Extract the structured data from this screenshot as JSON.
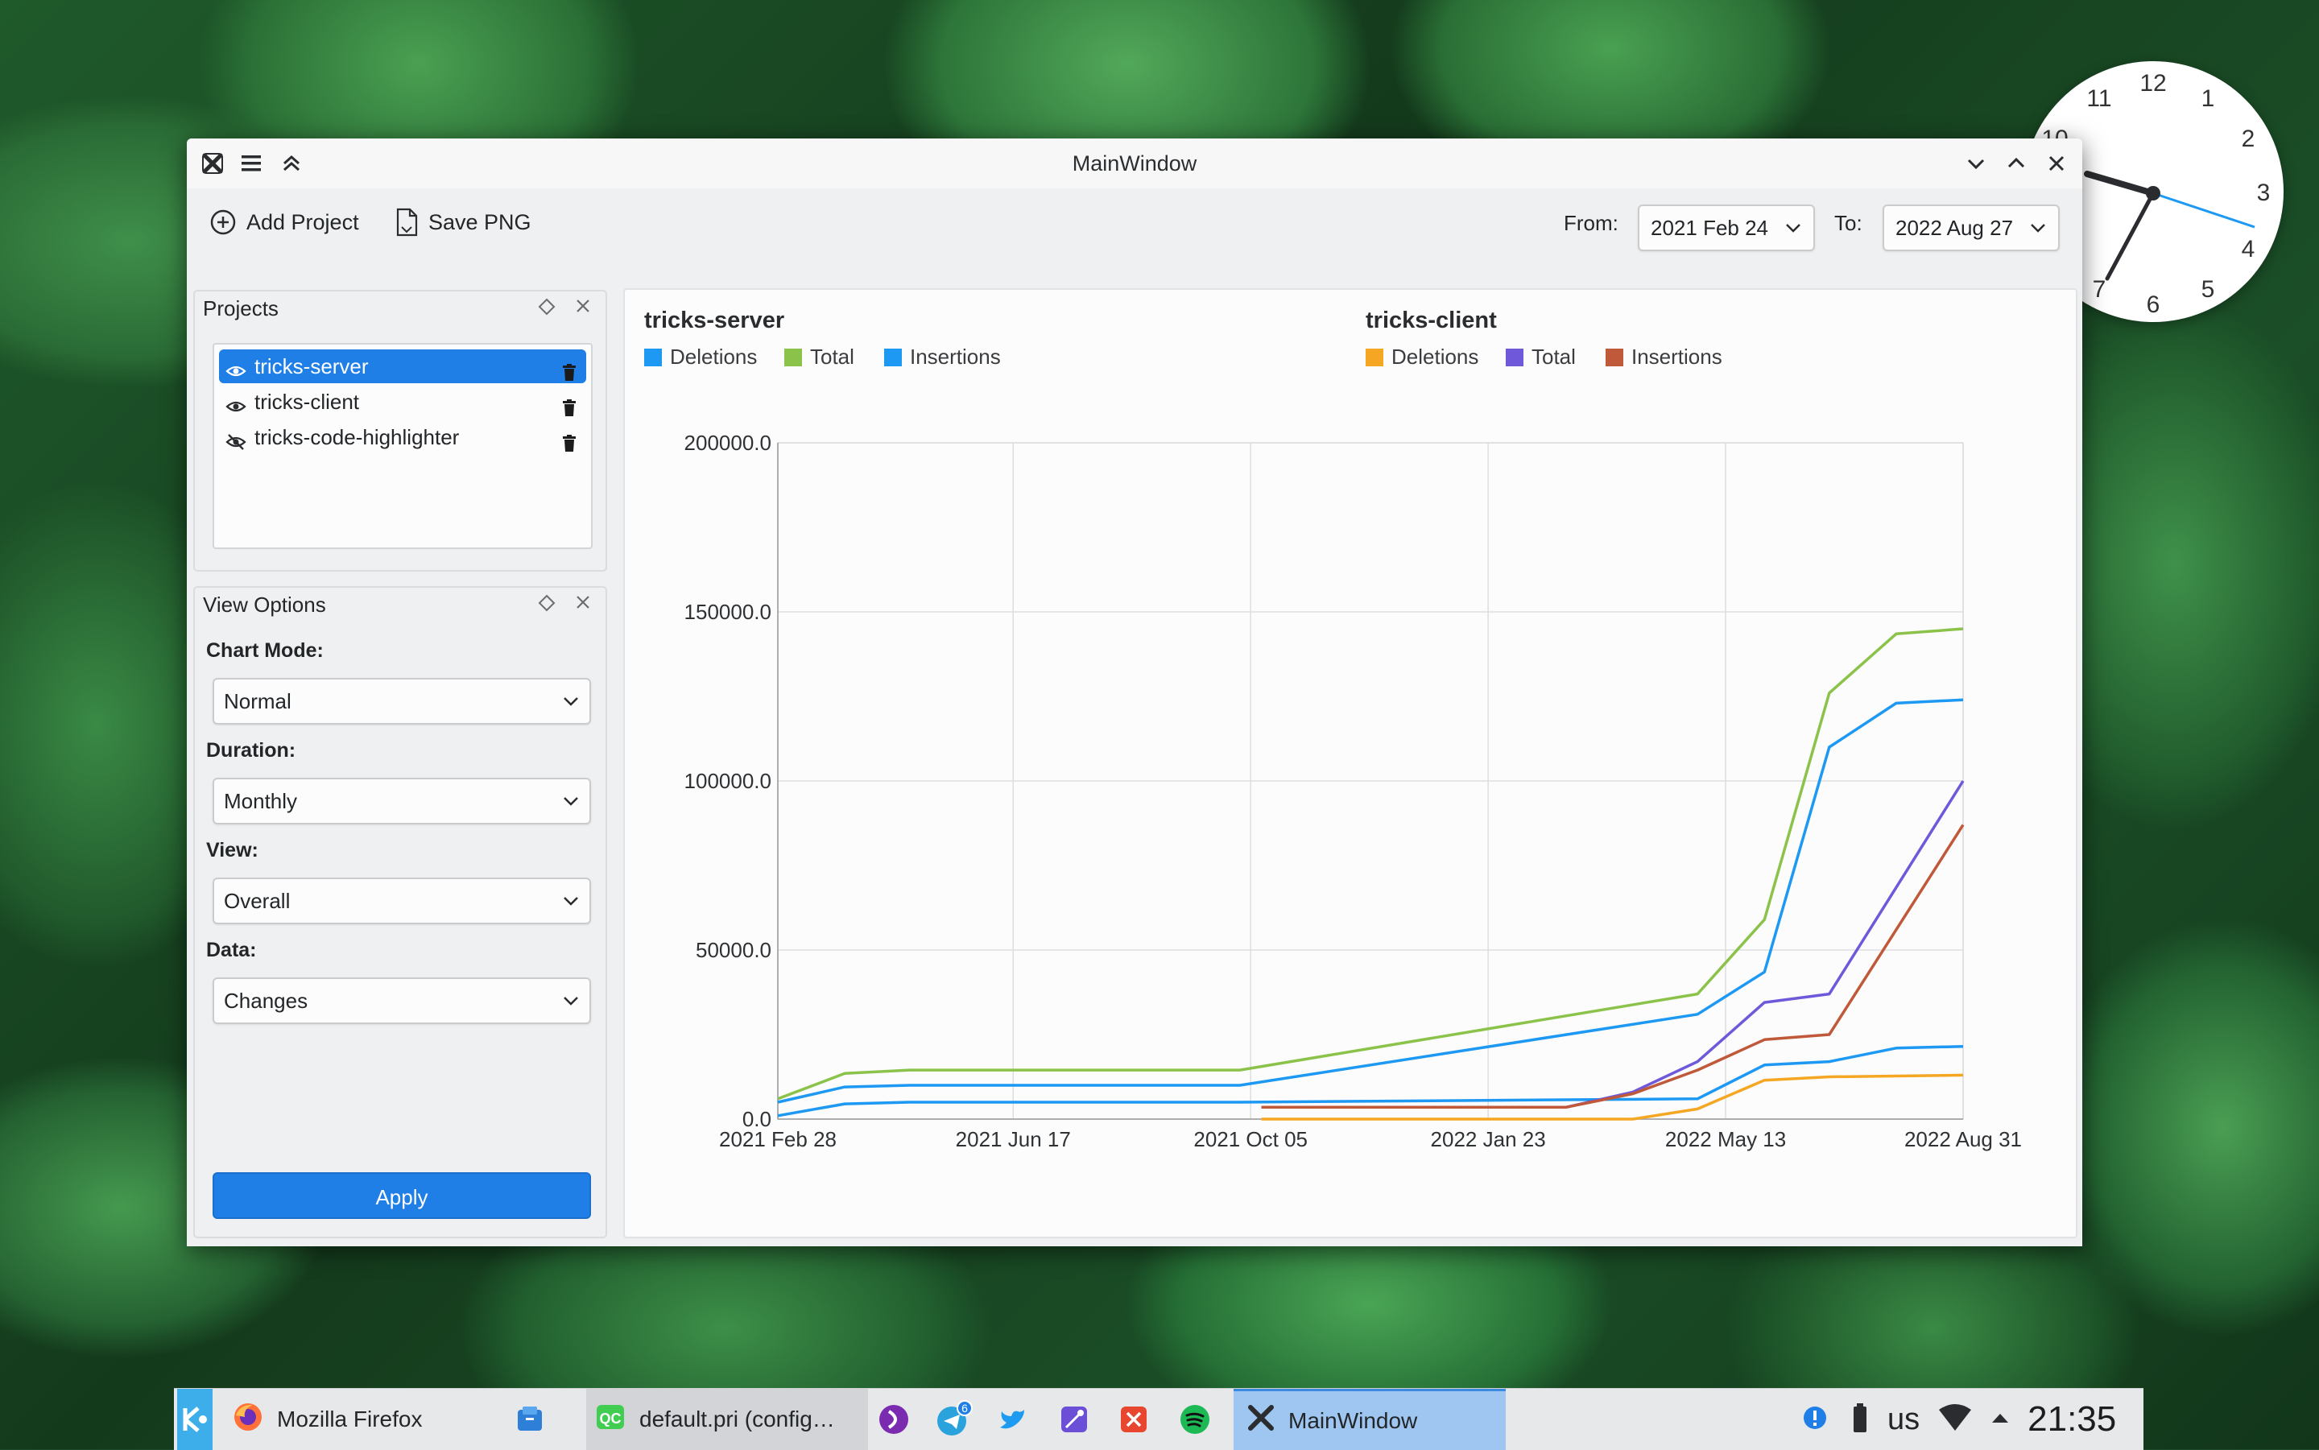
{
  "window": {
    "title": "MainWindow"
  },
  "toolbar": {
    "add_project": "Add Project",
    "save_png": "Save PNG",
    "from_label": "From:",
    "from_value": "2021 Feb 24",
    "to_label": "To:",
    "to_value": "2022 Aug 27"
  },
  "projects_dock": {
    "title": "Projects",
    "items": [
      {
        "label": "tricks-server",
        "visible": true,
        "selected": true
      },
      {
        "label": "tricks-client",
        "visible": true,
        "selected": false
      },
      {
        "label": "tricks-code-highlighter",
        "visible": false,
        "selected": false
      }
    ]
  },
  "view_options": {
    "title": "View Options",
    "chart_mode_label": "Chart Mode:",
    "chart_mode_value": "Normal",
    "duration_label": "Duration:",
    "duration_value": "Monthly",
    "view_label": "View:",
    "view_value": "Overall",
    "data_label": "Data:",
    "data_value": "Changes",
    "apply_label": "Apply"
  },
  "chart_data": {
    "type": "line",
    "projects": [
      {
        "name": "tricks-server",
        "legend": [
          "Deletions",
          "Total",
          "Insertions"
        ]
      },
      {
        "name": "tricks-client",
        "legend": [
          "Deletions",
          "Total",
          "Insertions"
        ]
      }
    ],
    "x_dates": [
      "2021-02-28",
      "2021-06-17",
      "2021-10-05",
      "2022-01-23",
      "2022-05-13",
      "2022-08-31"
    ],
    "x_tick_labels": [
      "2021 Feb 28",
      "2021 Jun 17",
      "2021 Oct 05",
      "2022 Jan 23",
      "2022 May 13",
      "2022 Aug 31"
    ],
    "y_tick_labels": [
      "0.0",
      "50000.0",
      "100000.0",
      "150000.0",
      "200000.0"
    ],
    "ylim": [
      0,
      200000
    ],
    "grid": true,
    "series": [
      {
        "project": "tricks-server",
        "name": "Deletions",
        "color": "#1d99f3",
        "points": [
          [
            "2021-02-28",
            1000
          ],
          [
            "2021-03-31",
            4500
          ],
          [
            "2021-04-30",
            5000
          ],
          [
            "2021-07-31",
            5000
          ],
          [
            "2021-09-30",
            5000
          ],
          [
            "2022-04-30",
            6000
          ],
          [
            "2022-05-31",
            16000
          ],
          [
            "2022-06-30",
            17000
          ],
          [
            "2022-07-31",
            21000
          ],
          [
            "2022-08-31",
            21500
          ]
        ]
      },
      {
        "project": "tricks-server",
        "name": "Total",
        "color": "#8bc34a",
        "points": [
          [
            "2021-02-28",
            6000
          ],
          [
            "2021-03-31",
            13500
          ],
          [
            "2021-04-30",
            14500
          ],
          [
            "2021-09-30",
            14500
          ],
          [
            "2022-04-30",
            37000
          ],
          [
            "2022-05-31",
            59000
          ],
          [
            "2022-06-30",
            126000
          ],
          [
            "2022-07-31",
            143500
          ],
          [
            "2022-08-31",
            145000
          ]
        ]
      },
      {
        "project": "tricks-server",
        "name": "Insertions",
        "color": "#1d99f3",
        "points": [
          [
            "2021-02-28",
            5000
          ],
          [
            "2021-03-31",
            9500
          ],
          [
            "2021-04-30",
            10000
          ],
          [
            "2021-09-30",
            10000
          ],
          [
            "2022-04-30",
            31000
          ],
          [
            "2022-05-31",
            43500
          ],
          [
            "2022-06-30",
            110000
          ],
          [
            "2022-07-31",
            123000
          ],
          [
            "2022-08-31",
            124000
          ]
        ]
      },
      {
        "project": "tricks-client",
        "name": "Deletions",
        "color": "#f5a623",
        "points": [
          [
            "2021-10-10",
            0
          ],
          [
            "2022-03-31",
            0
          ],
          [
            "2022-04-30",
            3000
          ],
          [
            "2022-05-31",
            11500
          ],
          [
            "2022-06-30",
            12500
          ],
          [
            "2022-08-31",
            13000
          ]
        ]
      },
      {
        "project": "tricks-client",
        "name": "Total",
        "color": "#6f58d9",
        "points": [
          [
            "2021-10-10",
            3500
          ],
          [
            "2022-02-28",
            3500
          ],
          [
            "2022-03-31",
            8000
          ],
          [
            "2022-04-30",
            17000
          ],
          [
            "2022-05-31",
            34500
          ],
          [
            "2022-06-30",
            37000
          ],
          [
            "2022-08-31",
            100000
          ]
        ]
      },
      {
        "project": "tricks-client",
        "name": "Insertions",
        "color": "#c0583a",
        "points": [
          [
            "2021-10-10",
            3500
          ],
          [
            "2022-02-28",
            3500
          ],
          [
            "2022-03-31",
            7500
          ],
          [
            "2022-04-30",
            14500
          ],
          [
            "2022-05-31",
            23500
          ],
          [
            "2022-06-30",
            25000
          ],
          [
            "2022-08-31",
            87000
          ]
        ]
      }
    ]
  },
  "clock": {
    "numbers": [
      "12",
      "1",
      "2",
      "3",
      "4",
      "5",
      "6",
      "7",
      "10",
      "11"
    ]
  },
  "taskbar": {
    "tasks": [
      {
        "label": "Mozilla Firefox",
        "icon": "firefox-icon"
      },
      {
        "label": "default.pri (config…",
        "icon": "qtcreator-icon"
      },
      {
        "label": "MainWindow",
        "icon": "kde-x-icon"
      }
    ],
    "telegram_badge": "6",
    "keyboard_layout": "us",
    "time": "21:35"
  }
}
